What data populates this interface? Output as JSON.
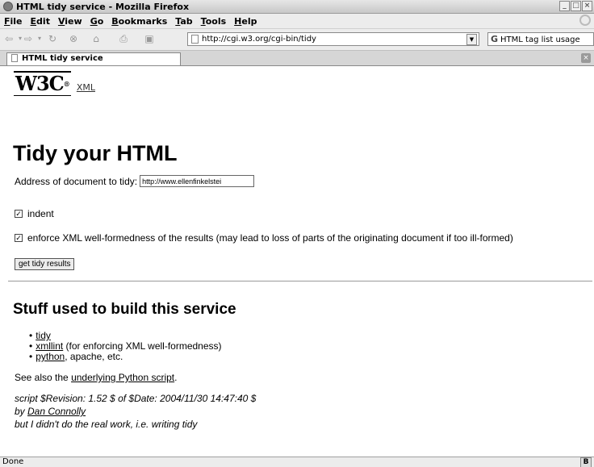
{
  "window": {
    "title": "HTML tidy service - Mozilla Firefox"
  },
  "menu": [
    "File",
    "Edit",
    "View",
    "Go",
    "Bookmarks",
    "Tab",
    "Tools",
    "Help"
  ],
  "nav": {
    "url": "http://cgi.w3.org/cgi-bin/tidy",
    "search_text": "HTML tag list usage"
  },
  "tab": {
    "label": "HTML tidy service"
  },
  "page": {
    "logo_text": "W3C",
    "logo_reg": "®",
    "xml_link": "XML",
    "heading": "Tidy your HTML",
    "address_label": "Address of document to tidy:",
    "address_value": "http://www.ellenfinkelstei",
    "indent_label": "indent",
    "enforce_label": "enforce XML well-formedness of the results (may lead to loss of parts of the originating document if too ill-formed)",
    "submit_label": "get tidy results",
    "subheading": "Stuff used to build this service",
    "list": {
      "item1_link": "tidy",
      "item2_link": "xmllint",
      "item2_text": " (for enforcing XML well-formedness)",
      "item3_link": "python",
      "item3_text": ", apache, etc."
    },
    "see_also_prefix": "See also the ",
    "see_also_link": "underlying Python script",
    "see_also_suffix": ".",
    "revision": "script $Revision: 1.52 $ of $Date: 2004/11/30 14:47:40 $",
    "by_prefix": "by ",
    "author_link": "Dan Connolly",
    "disclaimer": "but I didn't do the real work, i.e. writing tidy"
  },
  "status": {
    "text": "Done",
    "icon_label": "B"
  },
  "icons": [
    "back-icon",
    "forward-icon",
    "reload-icon",
    "stop-icon",
    "home-icon",
    "print-icon",
    "new-tab-icon",
    "page-icon",
    "dropdown-icon",
    "search-engine-icon",
    "close-tab-icon",
    "checkbox-icon"
  ]
}
